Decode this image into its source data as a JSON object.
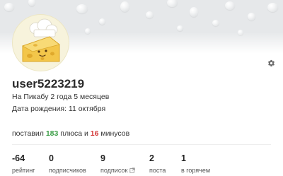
{
  "profile": {
    "username": "user5223219",
    "on_site": "На Пикабу 2 года 5 месяцев",
    "birthday": "Дата рождения: 11 октября"
  },
  "votes": {
    "prefix": "поставил",
    "plus_count": "183",
    "plus_word": "плюса и",
    "minus_count": "16",
    "minus_word": "минусов"
  },
  "stats": [
    {
      "value": "-64",
      "label": "рейтинг"
    },
    {
      "value": "0",
      "label": "подписчиков"
    },
    {
      "value": "9",
      "label": "подписок"
    },
    {
      "value": "2",
      "label": "поста"
    },
    {
      "value": "1",
      "label": "в горячем"
    }
  ],
  "icons": {
    "settings": "gear-icon",
    "external": "external-link-icon",
    "avatar": "cheese-chef-avatar"
  },
  "colors": {
    "plus": "#3c9e47",
    "minus": "#d43b3b",
    "cover": "#e6e8ea"
  }
}
